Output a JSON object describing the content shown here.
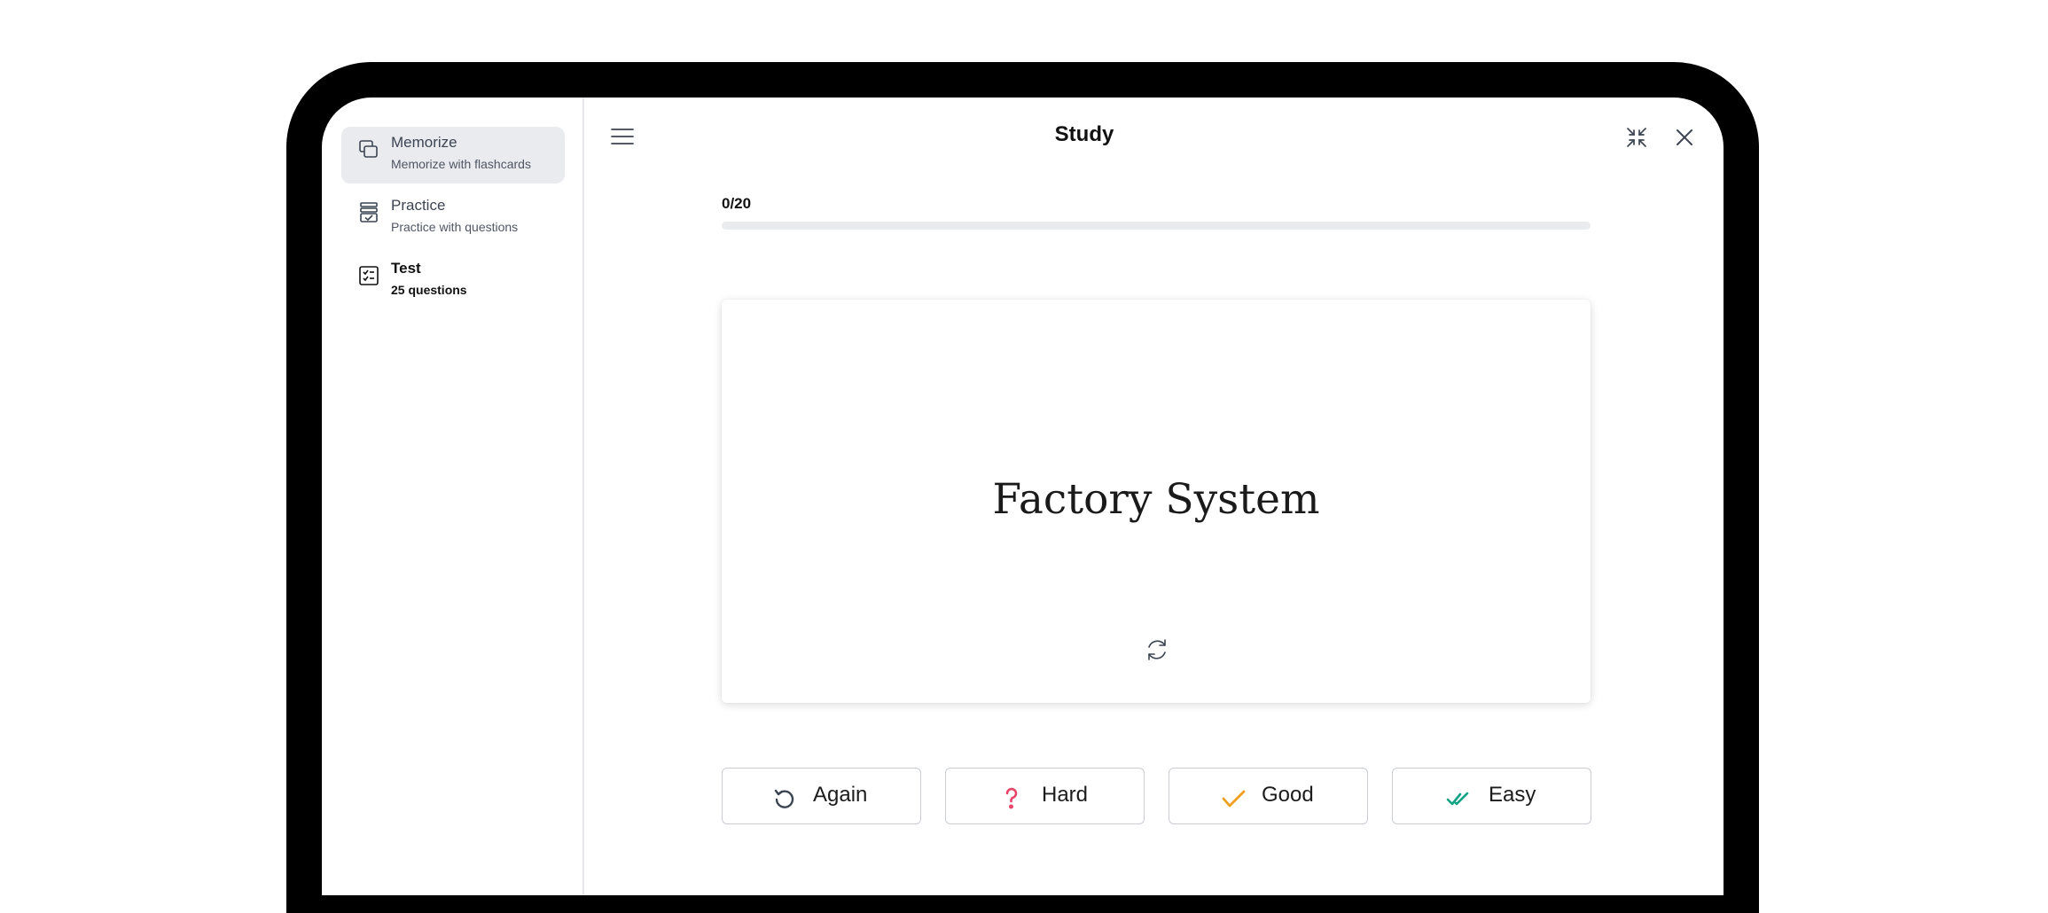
{
  "header": {
    "title": "Study"
  },
  "sidebar": {
    "items": [
      {
        "title": "Memorize",
        "subtitle": "Memorize with flashcards",
        "icon": "cards-icon"
      },
      {
        "title": "Practice",
        "subtitle": "Practice with questions",
        "icon": "stack-icon"
      },
      {
        "title": "Test",
        "subtitle": "25 questions",
        "icon": "checklist-icon"
      }
    ]
  },
  "progress": {
    "label": "0/20",
    "fraction": 0.0
  },
  "card": {
    "term": "Factory System"
  },
  "ratings": [
    {
      "label": "Again",
      "icon": "undo-icon",
      "color": "#3c4452"
    },
    {
      "label": "Hard",
      "icon": "question-icon",
      "color": "#e8456b"
    },
    {
      "label": "Good",
      "icon": "check-icon",
      "color": "#f0a020"
    },
    {
      "label": "Easy",
      "icon": "double-check-icon",
      "color": "#12a385"
    }
  ],
  "colors": {
    "frame": "#000000",
    "active_item_bg": "#e9ebef",
    "progress_track": "#e9ebee",
    "progress_fill": "#3d7be0"
  }
}
